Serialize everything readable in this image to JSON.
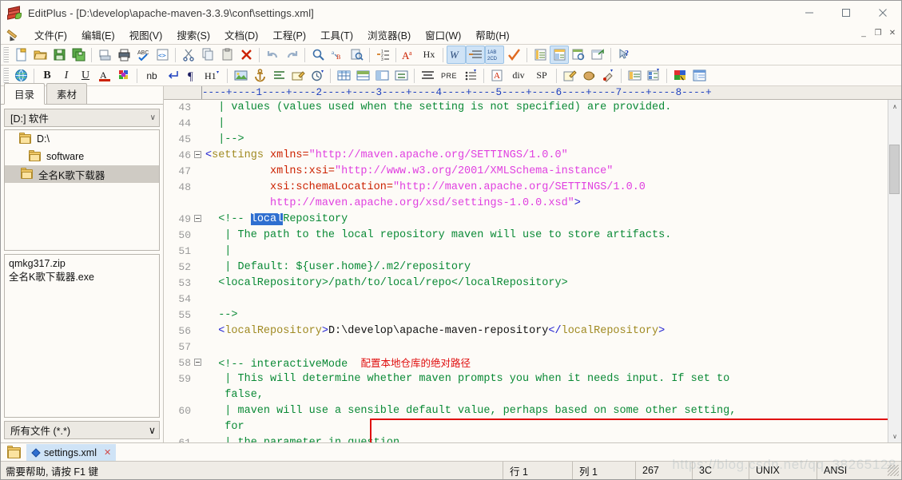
{
  "window": {
    "title": "EditPlus - [D:\\develop\\apache-maven-3.3.9\\conf\\settings.xml]",
    "minimize": "–",
    "maximize": "□",
    "close": "✕",
    "inner_minimize": "_",
    "inner_restore": "❐",
    "inner_close": "✕"
  },
  "menu": {
    "items": [
      {
        "label": "文件(F)"
      },
      {
        "label": "编辑(E)"
      },
      {
        "label": "视图(V)"
      },
      {
        "label": "搜索(S)"
      },
      {
        "label": "文档(D)"
      },
      {
        "label": "工程(P)"
      },
      {
        "label": "工具(T)"
      },
      {
        "label": "浏览器(B)"
      },
      {
        "label": "窗口(W)"
      },
      {
        "label": "帮助(H)"
      }
    ]
  },
  "toolbar1": {
    "icons": [
      "new-file-icon",
      "open-file-icon",
      "save-icon",
      "save-all-icon",
      "sep",
      "print-preview-icon",
      "print-icon",
      "spellcheck-icon",
      "view-source-icon",
      "sep",
      "cut-icon",
      "copy-icon",
      "paste-icon",
      "delete-icon",
      "sep",
      "undo-icon",
      "redo-icon",
      "sep",
      "find-icon",
      "replace-icon",
      "find-in-files-icon",
      "sep",
      "indent-list-icon",
      "sep",
      "uppercase-icon",
      "hex-icon",
      "sep",
      "word-wrap-icon",
      "line-numbers-icon",
      "toggle-case-icon",
      "spell-ok-icon",
      "sep",
      "document-selector-icon",
      "split-window-icon",
      "preview-icon",
      "browser-icon",
      "sep",
      "context-help-icon"
    ]
  },
  "toolbar2": {
    "icons": [
      "browser-globe-icon",
      "sep",
      "bold-icon",
      "italic-icon",
      "underline-icon",
      "font-color-icon",
      "color-palette-icon",
      "sep",
      "nbsp-icon",
      "line-break-icon",
      "paragraph-icon",
      "heading-icon",
      "sep",
      "image-icon",
      "anchor-icon",
      "align-icon",
      "edit-note-icon",
      "clock-icon",
      "sep",
      "table-icon",
      "table-row-icon",
      "table-cell-icon",
      "list-icon",
      "sep",
      "pre-tag-icon",
      "list-style-icon",
      "sep",
      "font-tag-icon",
      "div-tag-icon",
      "sp-tag-icon",
      "sep",
      "user-tool1-icon",
      "user-tool2-icon",
      "user-tool3-icon",
      "sep",
      "cliptext-icon",
      "clipboard-list-icon",
      "sep",
      "color-chooser-icon",
      "layout-icon"
    ],
    "labels": {
      "nb": "nb",
      "pre": "PRE",
      "div": "div",
      "sp": "SP",
      "h1": "H1",
      "bold": "B",
      "italic": "I",
      "underline": "U",
      "font_a": "A",
      "hex": "Hx",
      "aa": "A"
    }
  },
  "sidebar": {
    "tabs": [
      {
        "label": "目录",
        "active": true
      },
      {
        "label": "素材",
        "active": false
      }
    ],
    "drive_combo": "[D:] 软件",
    "drive_chevron": "∨",
    "tree": [
      {
        "label": "D:\\",
        "indent": 0,
        "selected": false
      },
      {
        "label": "software",
        "indent": 1,
        "selected": false
      },
      {
        "label": "全名K歌下载器",
        "indent": 2,
        "selected": true
      }
    ],
    "files": [
      {
        "name": "qmkg317.zip"
      },
      {
        "name": "全名K歌下载器.exe"
      }
    ],
    "filter_combo": "所有文件 (*.*)",
    "filter_chevron": "∨"
  },
  "editor": {
    "ruler": "----+----1----+----2----+----3----+----4----+----5----+----6----+----7----+----8----+",
    "scroll_up": "∧",
    "scroll_down": "∨",
    "lines": [
      {
        "num": "43",
        "fold": false,
        "parts": [
          {
            "t": "  | values (values used when the setting is not specified) are provided.",
            "c": "c-comment"
          }
        ]
      },
      {
        "num": "44",
        "fold": false,
        "parts": [
          {
            "t": "  |",
            "c": "c-comment"
          }
        ]
      },
      {
        "num": "45",
        "fold": false,
        "parts": [
          {
            "t": "  |-->",
            "c": "c-comment"
          }
        ]
      },
      {
        "num": "46",
        "fold": true,
        "parts": [
          {
            "t": "<",
            "c": "c-tag"
          },
          {
            "t": "settings ",
            "c": "c-tagname"
          },
          {
            "t": "xmlns=",
            "c": "c-attr"
          },
          {
            "t": "\"http://maven.apache.org/SETTINGS/1.0.0\"",
            "c": "c-str"
          }
        ]
      },
      {
        "num": "47",
        "fold": false,
        "parts": [
          {
            "t": "          ",
            "c": "c-plain"
          },
          {
            "t": "xmlns:xsi=",
            "c": "c-attr"
          },
          {
            "t": "\"http://www.w3.org/2001/XMLSchema-instance\"",
            "c": "c-str"
          }
        ]
      },
      {
        "num": "48",
        "fold": false,
        "parts": [
          {
            "t": "          ",
            "c": "c-plain"
          },
          {
            "t": "xsi:schemaLocation=",
            "c": "c-attr"
          },
          {
            "t": "\"http://maven.apache.org/SETTINGS/1.0.0",
            "c": "c-str"
          }
        ]
      },
      {
        "num": "",
        "fold": false,
        "parts": [
          {
            "t": "          ",
            "c": "c-plain"
          },
          {
            "t": "http://maven.apache.org/xsd/settings-1.0.0.xsd\"",
            "c": "c-str"
          },
          {
            "t": ">",
            "c": "c-tag"
          }
        ]
      },
      {
        "num": "49",
        "fold": true,
        "parts": [
          {
            "t": "  <!-- ",
            "c": "c-comment"
          },
          {
            "t": "local",
            "c": "c-comment sel-hl"
          },
          {
            "t": "Repository",
            "c": "c-comment"
          }
        ]
      },
      {
        "num": "50",
        "fold": false,
        "parts": [
          {
            "t": "   | The path to the local repository maven will use to store artifacts.",
            "c": "c-comment"
          }
        ]
      },
      {
        "num": "51",
        "fold": false,
        "parts": [
          {
            "t": "   |",
            "c": "c-comment"
          }
        ]
      },
      {
        "num": "52",
        "fold": false,
        "parts": [
          {
            "t": "   | Default: ${user.home}/.m2/repository",
            "c": "c-comment"
          }
        ]
      },
      {
        "num": "53",
        "fold": false,
        "parts": [
          {
            "t": "  <localRepository>/path/to/local/repo</localRepository>",
            "c": "c-comment"
          }
        ]
      },
      {
        "num": "54",
        "fold": false,
        "parts": []
      },
      {
        "num": "55",
        "fold": false,
        "parts": [
          {
            "t": "  -->",
            "c": "c-comment"
          }
        ]
      },
      {
        "num": "56",
        "fold": false,
        "parts": [
          {
            "t": "  <",
            "c": "c-tag"
          },
          {
            "t": "localRepository",
            "c": "c-tagname"
          },
          {
            "t": ">",
            "c": "c-tag"
          },
          {
            "t": "D:\\develop\\apache-maven-repository",
            "c": "c-plain"
          },
          {
            "t": "</",
            "c": "c-tag"
          },
          {
            "t": "localRepository",
            "c": "c-tagname"
          },
          {
            "t": ">",
            "c": "c-tag"
          }
        ]
      },
      {
        "num": "57",
        "fold": false,
        "parts": []
      },
      {
        "num": "58",
        "fold": true,
        "parts": [
          {
            "t": "  <!-- interactiveMode  ",
            "c": "c-comment"
          },
          {
            "t": "配置本地仓库的绝对路径",
            "c": "c-red"
          }
        ]
      },
      {
        "num": "59",
        "fold": false,
        "parts": [
          {
            "t": "   | This will determine whether maven prompts you when it needs input. If set to",
            "c": "c-comment"
          }
        ]
      },
      {
        "num": "",
        "fold": false,
        "parts": [
          {
            "t": "   false,",
            "c": "c-comment"
          }
        ]
      },
      {
        "num": "60",
        "fold": false,
        "parts": [
          {
            "t": "   | maven will use a sensible default value, perhaps based on some other setting,",
            "c": "c-comment"
          }
        ]
      },
      {
        "num": "",
        "fold": false,
        "parts": [
          {
            "t": "   for",
            "c": "c-comment"
          }
        ]
      },
      {
        "num": "61",
        "fold": false,
        "parts": [
          {
            "t": "   | the parameter in question.",
            "c": "c-comment"
          }
        ]
      }
    ]
  },
  "tabbar": {
    "folder_icon": "folder-icon",
    "documents": [
      {
        "label": "settings.xml",
        "close": "✕",
        "active": true
      }
    ]
  },
  "statusbar": {
    "message": "需要帮助, 请按 F1 键",
    "cells": [
      {
        "label": "行 1",
        "name": "row-indicator"
      },
      {
        "label": "列 1",
        "name": "col-indicator"
      },
      {
        "label": "267",
        "name": "char-offset-indicator"
      },
      {
        "label": "3C",
        "name": "char-code-indicator"
      },
      {
        "label": "UNIX",
        "name": "line-ending-indicator"
      },
      {
        "label": "ANSI",
        "name": "encoding-indicator"
      }
    ],
    "watermark": "https://blog.csdn.net/qq_38265128"
  },
  "colors": {
    "accent": "#cfe3f6",
    "comment": "#0a8a36",
    "tag": "#1c1cd0",
    "tagname": "#a08a22",
    "attr": "#cc2200",
    "string": "#e040e0",
    "annotation_red": "#e01010",
    "selection": "#2f6fd0",
    "chrome": "#fdfbf7"
  }
}
